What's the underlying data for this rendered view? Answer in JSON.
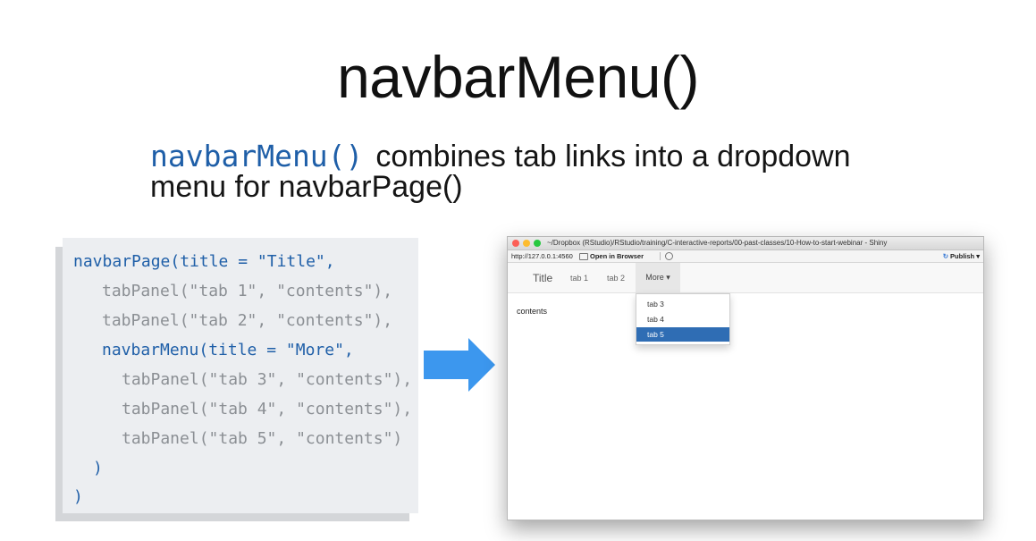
{
  "slide": {
    "title": "navbarMenu()",
    "subtitle_code": "navbarMenu()",
    "subtitle_line1": "combines tab links into a dropdown",
    "subtitle_line2": "menu for navbarPage()"
  },
  "code_lines": [
    "navbarPage(title = \"Title\",",
    "tabPanel(\"tab 1\", \"contents\"),",
    "tabPanel(\"tab 2\", \"contents\"),",
    "navbarMenu(title = \"More\",",
    "tabPanel(\"tab 3\", \"contents\"),",
    "tabPanel(\"tab 4\", \"contents\"),",
    "tabPanel(\"tab 5\", \"contents\")",
    ")",
    ")"
  ],
  "browser": {
    "window_title": "~/Dropbox (RStudio)/RStudio/training/C-interactive-reports/00-past-classes/10-How-to-start-webinar - Shiny",
    "url": "http://127.0.0.1:4560",
    "open_in_browser": "Open in Browser",
    "publish": "Publish",
    "navbar": {
      "brand": "Title",
      "tabs": [
        "tab 1",
        "tab 2"
      ],
      "more": "More"
    },
    "content": "contents",
    "dropdown": {
      "items": [
        "tab 3",
        "tab 4",
        "tab 5"
      ],
      "active_item": "tab 5"
    }
  },
  "colors": {
    "code_blue": "#1f5fa8",
    "arrow_blue": "#3c97ee",
    "dropdown_active": "#2f6db4"
  },
  "icons": {
    "arrow": "right-arrow-icon",
    "publish": "publish-icon",
    "open_in_browser": "open-in-browser-icon",
    "refresh": "refresh-icon"
  }
}
